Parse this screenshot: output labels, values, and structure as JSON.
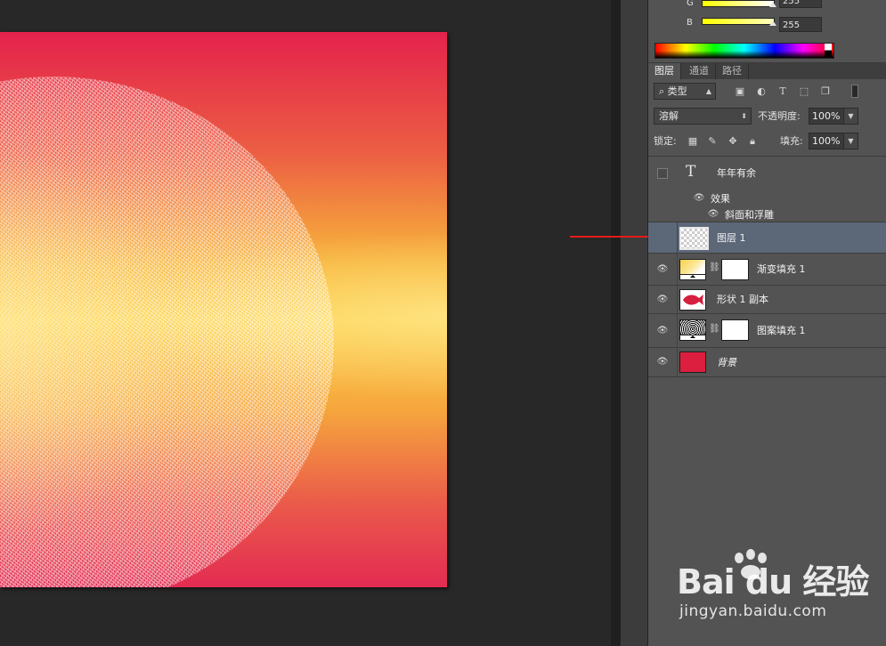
{
  "color_panel": {
    "channels": [
      {
        "label": "G",
        "value": "255",
        "color": "#ffffff"
      },
      {
        "label": "B",
        "value": "255",
        "color": "#ffff00"
      }
    ]
  },
  "tabs": [
    {
      "label": "图层",
      "active": true
    },
    {
      "label": "通道",
      "active": false
    },
    {
      "label": "路径",
      "active": false
    }
  ],
  "filter": {
    "search_glyph": "⌕",
    "kind_label": "类型",
    "icons": [
      "image-filter-icon",
      "adjustment-filter-icon",
      "type-filter-icon",
      "shape-filter-icon",
      "smart-object-filter-icon",
      "filter-toggle-icon"
    ]
  },
  "blend": {
    "mode": "溶解",
    "opacity_label": "不透明度:",
    "opacity_value": "100%"
  },
  "lock": {
    "label": "锁定:",
    "fill_label": "填充:",
    "fill_value": "100%"
  },
  "layers": [
    {
      "name": "年年有余",
      "type": "text",
      "visible": false,
      "selected": false
    },
    {
      "name": "效果",
      "type": "effects-group"
    },
    {
      "name": "斜面和浮雕",
      "type": "effect"
    },
    {
      "name": "图层 1",
      "type": "pixel",
      "visible": false,
      "selected": true
    },
    {
      "name": "渐变填充 1",
      "type": "gradient-fill",
      "visible": true,
      "selected": false
    },
    {
      "name": "形状 1 副本",
      "type": "shape",
      "visible": true,
      "selected": false
    },
    {
      "name": "图案填充 1",
      "type": "pattern-fill",
      "visible": true,
      "selected": false
    },
    {
      "name": "背景",
      "type": "background",
      "visible": true,
      "selected": false,
      "color": "#dc1f3f"
    }
  ],
  "watermark": {
    "brand": "Bai du 经验",
    "url": "jingyan.baidu.com"
  },
  "colors": {
    "accent_arrow": "#e51a1a",
    "panel_bg": "#535353",
    "selected_row": "#5c6778"
  }
}
